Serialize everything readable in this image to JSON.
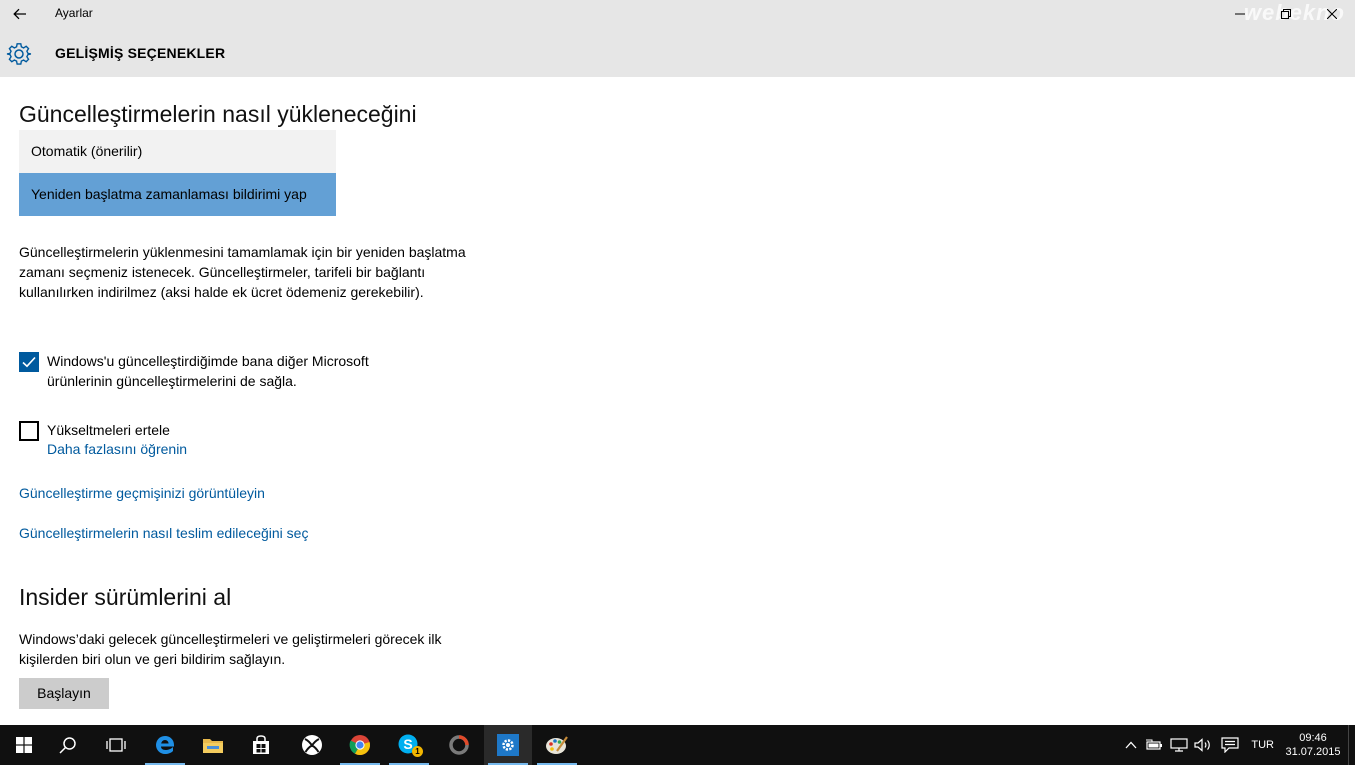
{
  "window": {
    "app_title": "Ayarlar",
    "page_title": "GELİŞMİŞ SEÇENEKLER",
    "watermark": "webekno"
  },
  "install": {
    "heading": "Güncelleştirmelerin nasıl yükleneceğini",
    "options": [
      "Otomatik (önerilir)",
      "Yeniden başlatma zamanlaması bildirimi yap"
    ],
    "selected_index": 1,
    "description": "Güncelleştirmelerin yüklenmesini tamamlamak için bir yeniden başlatma zamanı seçmeniz istenecek. Güncelleştirmeler, tarifeli bir bağlantı kullanılırken indirilmez (aksi halde ek ücret ödemeniz gerekebilir)."
  },
  "checkboxes": {
    "microsoft_products": {
      "label": "Windows'u güncelleştirdiğimde bana diğer Microsoft ürünlerinin güncelleştirmelerini de sağla.",
      "checked": true
    },
    "defer_upgrades": {
      "label": "Yükseltmeleri ertele",
      "checked": false,
      "learn_more": "Daha fazlasını öğrenin"
    }
  },
  "links": {
    "history": "Güncelleştirme geçmişinizi görüntüleyin",
    "delivery": "Güncelleştirmelerin nasıl teslim edileceğini seç"
  },
  "insider": {
    "heading": "Insider sürümlerini al",
    "description": "Windows’daki gelecek güncelleştirmeleri ve geliştirmeleri görecek ilk kişilerden biri olun ve geri bildirim sağlayın.",
    "button": "Başlayın"
  },
  "taskbar": {
    "apps": [
      "start-icon",
      "search-icon",
      "task-view-icon",
      "edge-icon",
      "file-explorer-icon",
      "store-icon",
      "xbox-icon",
      "chrome-icon",
      "skype-icon",
      "app-icon",
      "settings-icon",
      "paint-icon"
    ],
    "skype_badge": "1",
    "language": "TUR",
    "time": "09:46",
    "date": "31.07.2015"
  },
  "colors": {
    "accent": "#005a9e",
    "selected_option": "#63a0d5",
    "titlebar": "#e6e6e6",
    "taskbar": "#101010"
  }
}
